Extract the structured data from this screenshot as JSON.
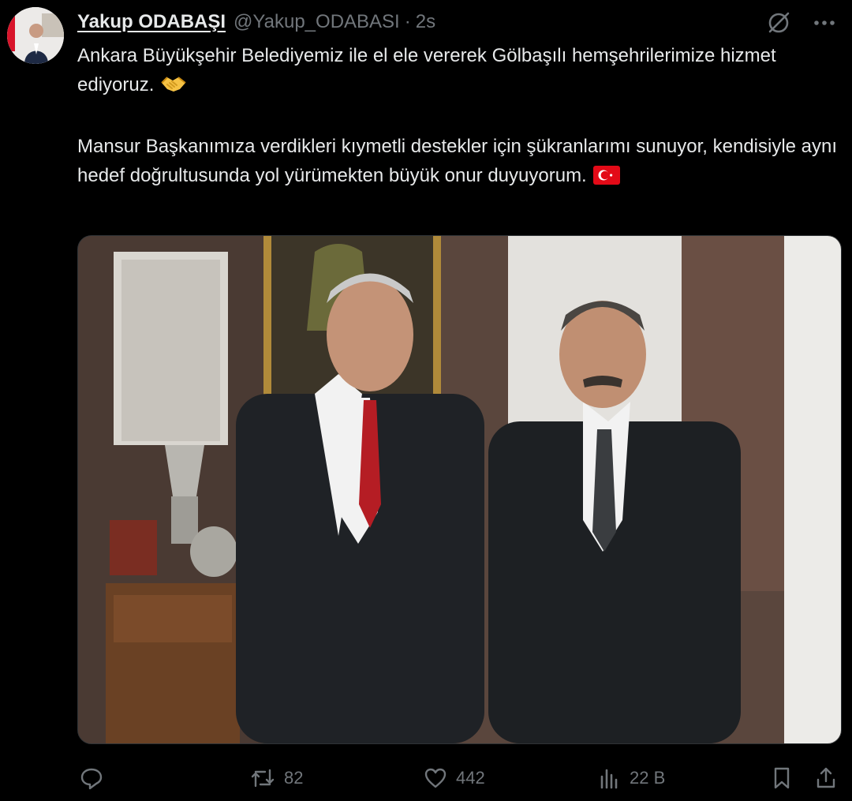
{
  "tweet": {
    "display_name": "Yakup ODABAŞI",
    "handle": "@Yakup_ODABASI",
    "separator": "·",
    "time": "2s",
    "text_para1": "Ankara Büyükşehir Belediyemiz ile el ele vererek Gölbaşılı hemşehrilerimize hizmet ediyoruz.",
    "text_para2": "Mansur Başkanımıza verdikleri kıymetli destekler için şükranlarımı sunuyor, kendisiyle aynı hedef doğrultusunda yol yürümekten büyük onur duyuyorum.",
    "emoji1": "handshake-emoji",
    "emoji2": "turkey-flag-emoji"
  },
  "header_icons": [
    "grok-icon",
    "more-icon"
  ],
  "actions": {
    "reply_count": "",
    "retweet_count": "82",
    "like_count": "442",
    "views_count": "22 B"
  },
  "colors": {
    "background": "#000000",
    "text": "#e7e9ea",
    "muted": "#71767b",
    "flag_red": "#e30a17"
  }
}
